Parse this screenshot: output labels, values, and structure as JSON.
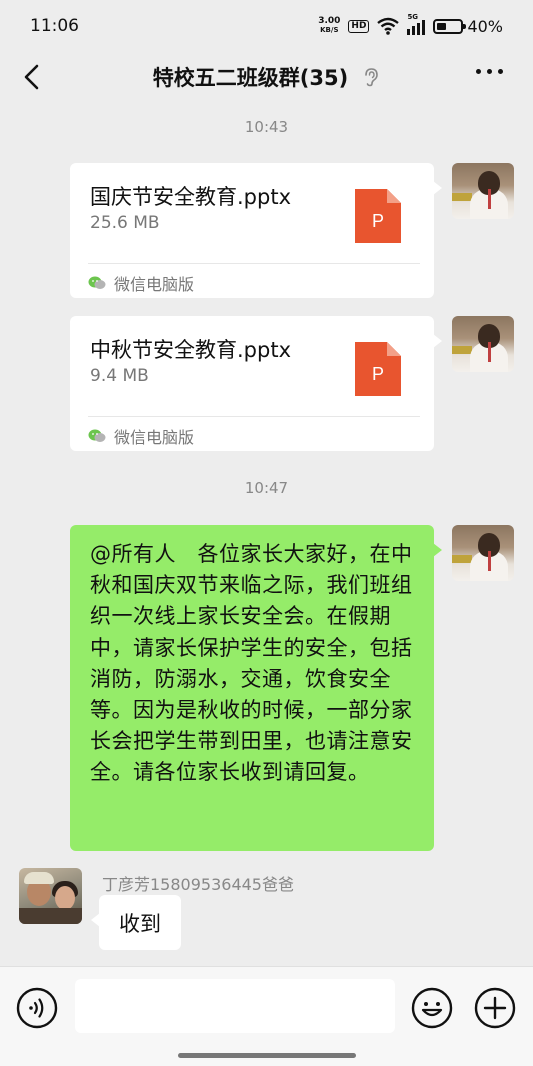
{
  "status_bar": {
    "time": "11:06",
    "net_speed_value": "3.00",
    "net_speed_unit": "KB/S",
    "hd_label": "HD",
    "signal_label": "5G",
    "battery_percent": "40%",
    "battery_level": 0.4
  },
  "header": {
    "title": "特校五二班级群(35)"
  },
  "messages": {
    "time_1": "10:43",
    "file_1": {
      "name": "国庆节安全教育.pptx",
      "size": "25.6 MB",
      "icon_letter": "P",
      "source": "微信电脑版"
    },
    "file_2": {
      "name": "中秋节安全教育.pptx",
      "size": "9.4 MB",
      "icon_letter": "P",
      "source": "微信电脑版"
    },
    "time_2": "10:47",
    "announcement": "@所有人　各位家长大家好，在中秋和国庆双节来临之际，我们班组织一次线上家长安全会。在假期中，请家长保护学生的安全，包括消防，防溺水，交通，饮食安全等。因为是秋收的时候，一部分家长会把学生带到田里，也请注意安全。请各位家长收到请回复。",
    "reply": {
      "sender": "丁彦芳15809536445爸爸",
      "text": "收到"
    }
  },
  "colors": {
    "chat_background": "#ededed",
    "sent_bubble": "#95ec69",
    "ppt_icon": "#e8552f"
  },
  "icons": [
    "back-arrow-icon",
    "ear-icon",
    "more-icon",
    "ppt-file-icon",
    "wechat-icon",
    "voice-icon",
    "emoji-icon",
    "plus-icon"
  ]
}
